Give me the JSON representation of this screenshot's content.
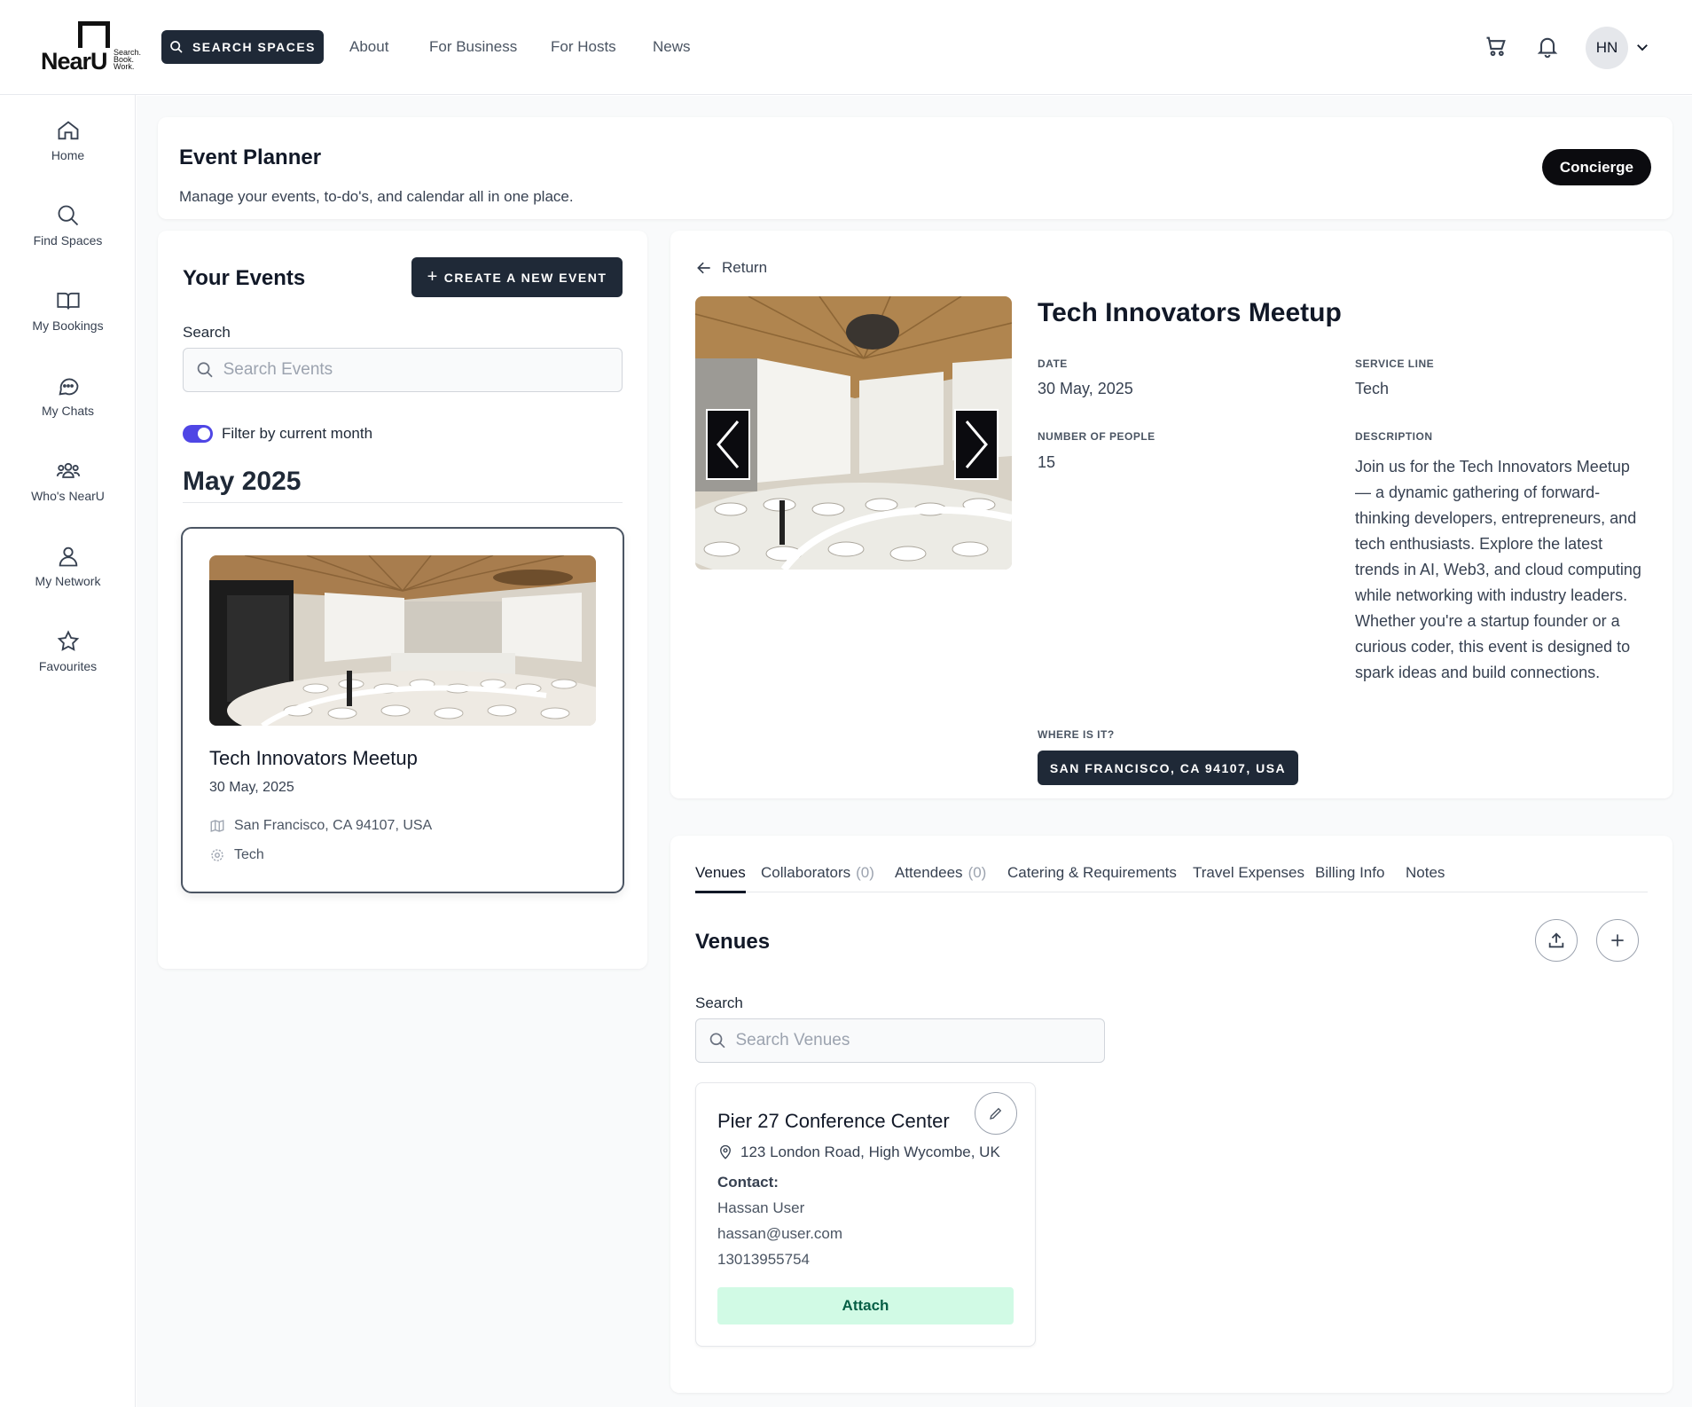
{
  "brand": {
    "name": "NearU",
    "tagline_lines": [
      "Search.",
      "Book.",
      "Work."
    ]
  },
  "header": {
    "search_spaces_label": "SEARCH SPACES",
    "nav": [
      "About",
      "For Business",
      "For Hosts",
      "News"
    ],
    "avatar_initials": "HN"
  },
  "sidebar": {
    "items": [
      {
        "label": "Home",
        "icon": "home-icon"
      },
      {
        "label": "Find Spaces",
        "icon": "search-icon"
      },
      {
        "label": "My Bookings",
        "icon": "book-icon"
      },
      {
        "label": "My Chats",
        "icon": "chat-icon"
      },
      {
        "label": "Who's NearU",
        "icon": "people-icon"
      },
      {
        "label": "My Network",
        "icon": "user-icon"
      },
      {
        "label": "Favourites",
        "icon": "star-icon"
      }
    ]
  },
  "planner": {
    "title": "Event Planner",
    "subtitle": "Manage your events, to-do's, and calendar all in one place.",
    "concierge_label": "Concierge"
  },
  "events_panel": {
    "title": "Your Events",
    "create_label": "CREATE A NEW EVENT",
    "search_label": "Search",
    "search_placeholder": "Search Events",
    "filter_label": "Filter by current month",
    "filter_on": true,
    "month_heading": "May 2025",
    "events": [
      {
        "title": "Tech Innovators Meetup",
        "date": "30 May, 2025",
        "location": "San Francisco, CA 94107, USA",
        "service_line": "Tech"
      }
    ]
  },
  "event_detail": {
    "return_label": "Return",
    "title": "Tech Innovators Meetup",
    "date_caption": "DATE",
    "date": "30 May, 2025",
    "service_caption": "SERVICE LINE",
    "service_line": "Tech",
    "people_caption": "NUMBER OF PEOPLE",
    "people": "15",
    "description_caption": "DESCRIPTION",
    "description": "Join us for the Tech Innovators Meetup — a dynamic gathering of forward-thinking developers, entrepreneurs, and tech enthusiasts. Explore the latest trends in AI, Web3, and cloud computing while networking with industry leaders. Whether you're a startup founder or a curious coder, this event is designed to spark ideas and build connections.",
    "where_caption": "WHERE IS IT?",
    "where_label": "SAN FRANCISCO, CA 94107, USA"
  },
  "tabs": [
    {
      "label": "Venues",
      "count": ""
    },
    {
      "label": "Collaborators",
      "count": "(0)"
    },
    {
      "label": "Attendees",
      "count": "(0)"
    },
    {
      "label": "Catering & Requirements",
      "count": ""
    },
    {
      "label": "Travel Expenses",
      "count": ""
    },
    {
      "label": "Billing Info",
      "count": ""
    },
    {
      "label": "Notes",
      "count": ""
    }
  ],
  "venues": {
    "heading": "Venues",
    "search_label": "Search",
    "search_placeholder": "Search Venues",
    "items": [
      {
        "name": "Pier 27 Conference Center",
        "address": "123 London Road, High Wycombe, UK",
        "contact_label": "Contact:",
        "contact_name": "Hassan User",
        "contact_email": "hassan@user.com",
        "contact_phone": "13013955754",
        "attach_label": "Attach"
      }
    ]
  },
  "colors": {
    "dark": "#1f2937",
    "accent": "#4f46e5",
    "attach_bg": "#d1fae5"
  }
}
